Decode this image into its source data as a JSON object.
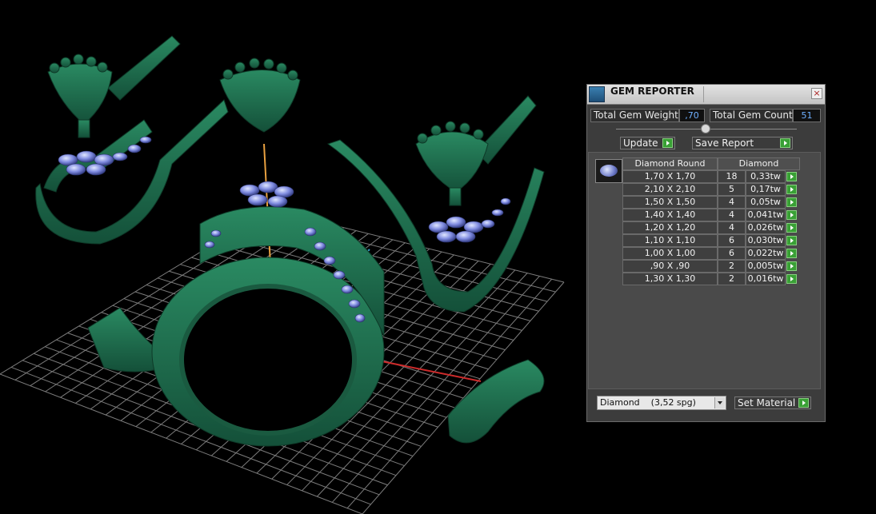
{
  "panel": {
    "title": "GEM REPORTER",
    "close_label": "×",
    "total_gem_weight_label": "Total Gem Weight",
    "total_gem_weight_value": ",70",
    "total_gem_count_label": "Total Gem Count",
    "total_gem_count_value": "51",
    "update_label": "Update",
    "save_report_label": "Save Report",
    "table": {
      "col_size": "Diamond Round",
      "col_material": "Diamond",
      "rows": [
        {
          "size": "1,70 X 1,70",
          "count": "18",
          "weight": "0,33tw"
        },
        {
          "size": "2,10 X 2,10",
          "count": "5",
          "weight": "0,17tw"
        },
        {
          "size": "1,50 X 1,50",
          "count": "4",
          "weight": "0,05tw"
        },
        {
          "size": "1,40 X 1,40",
          "count": "4",
          "weight": "0,041tw"
        },
        {
          "size": "1,20 X 1,20",
          "count": "4",
          "weight": "0,026tw"
        },
        {
          "size": "1,10 X 1,10",
          "count": "6",
          "weight": "0,030tw"
        },
        {
          "size": "1,00 X 1,00",
          "count": "6",
          "weight": "0,022tw"
        },
        {
          "size": ",90 X ,90",
          "count": "2",
          "weight": "0,005tw"
        },
        {
          "size": "1,30 X 1,30",
          "count": "2",
          "weight": "0,016tw"
        }
      ]
    },
    "material_select_value": "Diamond    (3,52 spg)",
    "set_material_label": "Set Material"
  },
  "colors": {
    "model_green": "#1f6b4c",
    "gem_blue": "#7f8be0",
    "grid": "#8a8a8a",
    "axis_x": "#cc2b2b",
    "axis_y": "#e8a040",
    "axis_z": "#3aa0d0",
    "go_button": "#39a035",
    "value_text": "#6fb0ff"
  }
}
